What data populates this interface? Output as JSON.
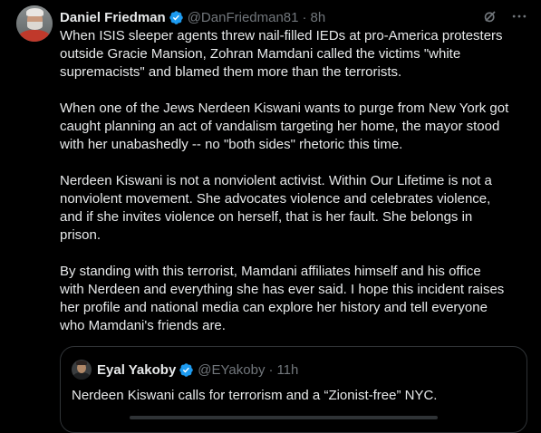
{
  "tweet": {
    "author": {
      "display_name": "Daniel Friedman",
      "handle": "@DanFriedman81",
      "separator": "·",
      "time": "8h",
      "verified": true
    },
    "paragraphs": [
      "When ISIS sleeper agents threw nail-filled IEDs at pro-America protesters\noutside Gracie Mansion, Zohran Mamdani called the victims \"white\nsupremacists\" and blamed them more than the terrorists.",
      "When one of the Jews Nerdeen Kiswani wants to purge from New York got\ncaught planning an act of vandalism targeting her home, the mayor stood\nwith her unabashedly -- no \"both sides\" rhetoric this time.",
      "Nerdeen Kiswani is not a nonviolent activist.  Within Our Lifetime is not a\nnonviolent movement.  She advocates violence and celebrates violence,\nand if she invites violence on herself, that is her fault.  She belongs in\nprison.",
      "By standing with this terrorist, Mamdani affiliates himself and his office\nwith Nerdeen and everything she has ever said.  I hope this incident raises\nher profile and national media can explore her history and tell everyone\nwho Mamdani's friends are."
    ]
  },
  "quote": {
    "author": {
      "display_name": "Eyal Yakoby",
      "handle": "@EYakoby",
      "separator": "·",
      "time": "11h",
      "verified": true
    },
    "text": "Nerdeen Kiswani calls for terrorism and a “Zionist-free” NYC."
  },
  "icons": {
    "verified": "verified-badge-icon",
    "grok": "grok-icon",
    "more": "more-icon"
  },
  "colors": {
    "background": "#000000",
    "text": "#e7e9ea",
    "muted": "#71767b",
    "verified": "#1d9bf0",
    "border": "#2f3336"
  }
}
